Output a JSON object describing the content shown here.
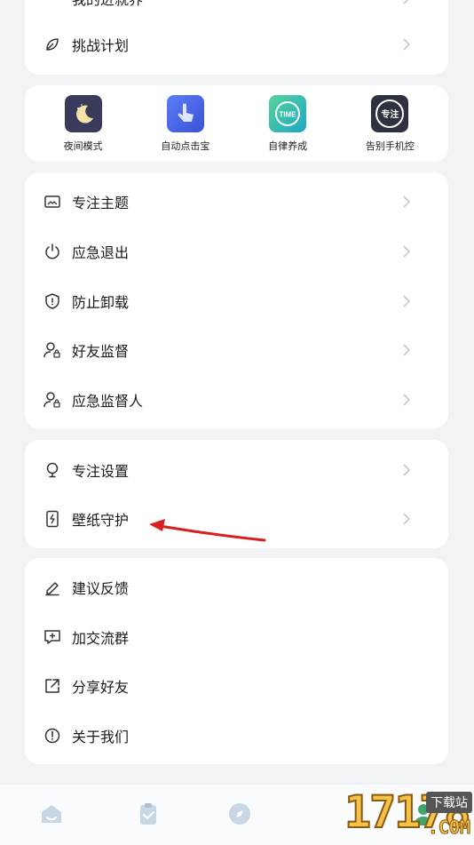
{
  "top_card": {
    "cut_label": "我的进就界",
    "challenge_label": "挑战计划"
  },
  "quick_apps": [
    {
      "label": "夜间模式",
      "icon": "moon-icon",
      "color": "#3a3b5a"
    },
    {
      "label": "自动点击宝",
      "icon": "tap-hand-icon",
      "color": "#4a62e8"
    },
    {
      "label": "自律养成",
      "icon": "time-icon",
      "color": "#2fb8a8"
    },
    {
      "label": "告别手机控",
      "icon": "focus-badge-icon",
      "color": "#2e3140",
      "badge_text": "专注"
    }
  ],
  "focus_menu": [
    {
      "label": "专注主题",
      "icon": "image-icon"
    },
    {
      "label": "应急退出",
      "icon": "power-icon"
    },
    {
      "label": "防止卸载",
      "icon": "shield-icon"
    },
    {
      "label": "好友监督",
      "icon": "user-lock-icon"
    },
    {
      "label": "应急监督人",
      "icon": "user-lock-icon"
    }
  ],
  "settings_menu": [
    {
      "label": "专注设置",
      "icon": "bulb-icon"
    },
    {
      "label": "壁纸守护",
      "icon": "phone-bolt-icon"
    }
  ],
  "misc_menu": [
    {
      "label": "建议反馈",
      "icon": "edit-icon"
    },
    {
      "label": "加交流群",
      "icon": "chat-plus-icon"
    },
    {
      "label": "分享好友",
      "icon": "share-icon"
    },
    {
      "label": "关于我们",
      "icon": "info-icon"
    }
  ],
  "annotation": {
    "color": "#d8201e"
  },
  "tabbar": [
    {
      "icon": "home-icon"
    },
    {
      "icon": "clipboard-check-icon"
    },
    {
      "icon": "compass-icon"
    },
    {
      "icon": "profile-icon"
    }
  ],
  "watermark": {
    "text": "17178",
    "sub": "下载站",
    "suffix": ".COM"
  },
  "colors": {
    "background": "#f2f3f5",
    "card": "#ffffff",
    "chevron": "#c4c7cc",
    "icon": "#333333"
  }
}
